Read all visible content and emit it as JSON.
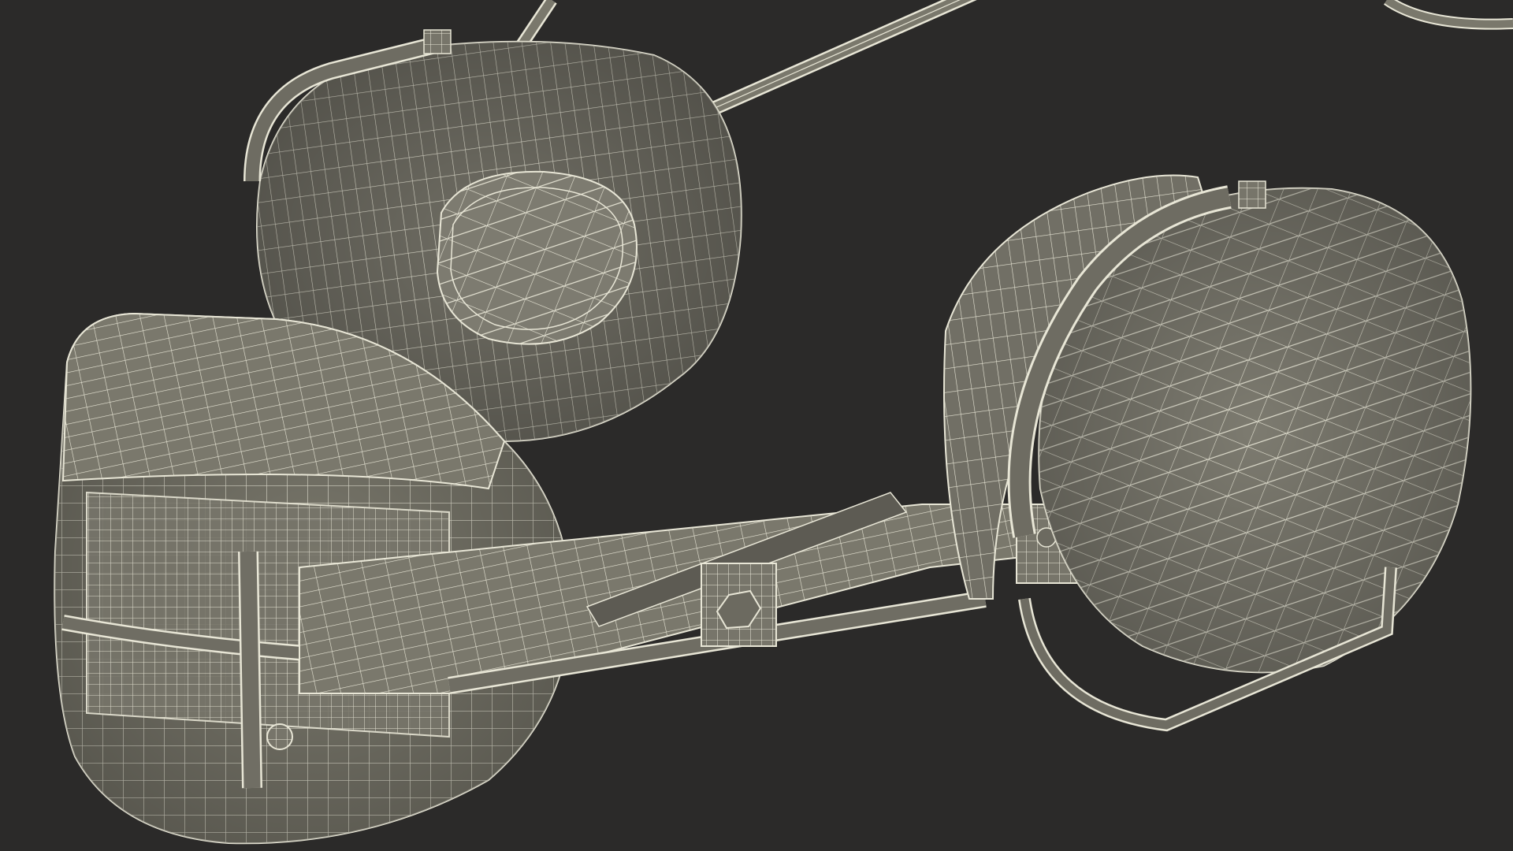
{
  "scene": {
    "subject_icon": "headset-wireframe-icon",
    "colors": {
      "background": "#2b2a29",
      "surface": "#7a786c",
      "surface_dark": "#65635a",
      "surface_light": "#8c8a7e",
      "wire": "#e8e6d6"
    }
  }
}
